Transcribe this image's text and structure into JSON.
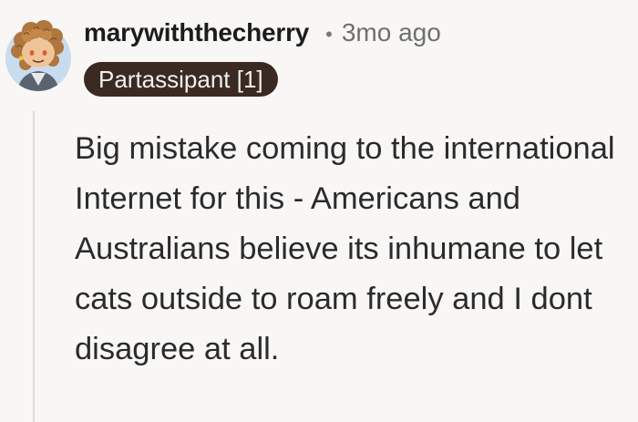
{
  "comment": {
    "username": "marywiththecherry",
    "separator": "•",
    "timestamp": "3mo ago",
    "flair": "Partassipant [1]",
    "body": "Big mistake coming to the international Internet for this - Americans and Australians believe its inhumane to let cats outside to roam freely and I dont disagree at all."
  },
  "avatar": {
    "icon": "snoo-avatar-icon",
    "background": "#c9dcef"
  },
  "colors": {
    "page_background": "#f8f7f5",
    "flair_background": "#3a2a22",
    "flair_text": "#f1f1f1",
    "thread_line": "#dcdcdc"
  }
}
